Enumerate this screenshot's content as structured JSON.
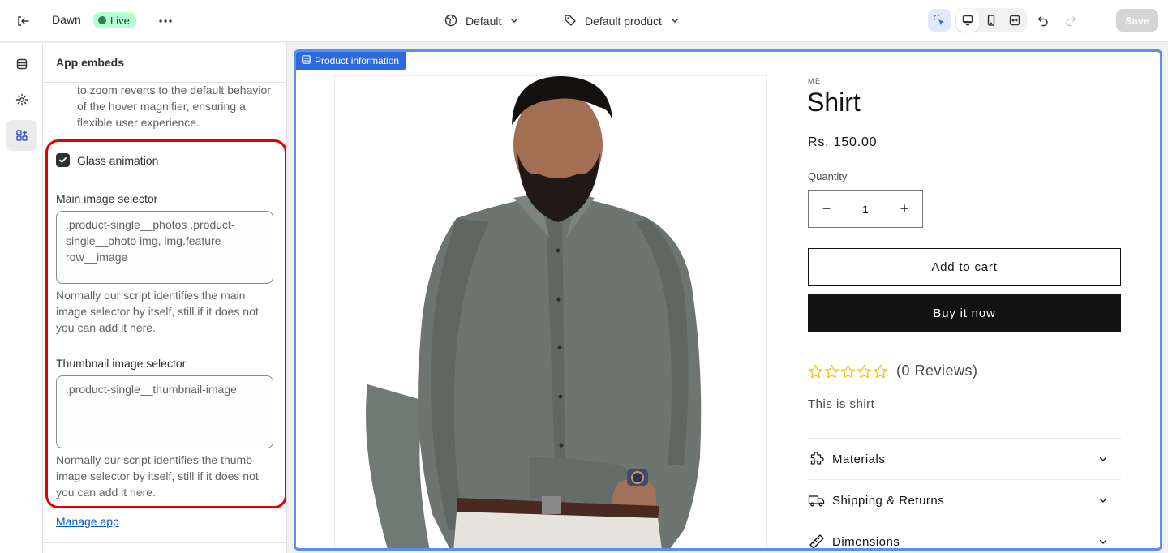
{
  "topbar": {
    "theme_name": "Dawn",
    "status": "Live",
    "more_label": "•••",
    "template_selector": "Default",
    "product_selector": "Default product",
    "save_label": "Save"
  },
  "panel": {
    "title": "App embeds",
    "help_top": "to zoom reverts to the default behavior of the hover magnifier, ensuring a flexible user experience.",
    "checkbox_label": "Glass animation",
    "main_selector": {
      "label": "Main image selector",
      "value": ".product-single__photos .product-single__photo img, img.feature-row__image",
      "help": "Normally our script identifies the main image selector by itself, still if it does not you can add it here."
    },
    "thumb_selector": {
      "label": "Thumbnail image selector",
      "value": ".product-single__thumbnail-image",
      "help": "Normally our script identifies the thumb image selector by itself, still if it does not you can add it here."
    },
    "manage_link": "Manage app"
  },
  "preview": {
    "section_tag": "Product information",
    "vendor": "ME",
    "title": "Shirt",
    "price": "Rs. 150.00",
    "quantity_label": "Quantity",
    "quantity_value": "1",
    "add_to_cart": "Add to cart",
    "buy_now": "Buy it now",
    "rating": 0,
    "rating_max": 5,
    "reviews": "(0 Reviews)",
    "description": "This is shirt",
    "accordions": [
      {
        "label": "Materials",
        "icon": "puzzle-icon"
      },
      {
        "label": "Shipping & Returns",
        "icon": "truck-icon"
      },
      {
        "label": "Dimensions",
        "icon": "ruler-icon"
      }
    ]
  },
  "colors": {
    "live_badge_bg": "#b4fed2",
    "selection_outline": "#5a8ff0",
    "section_tag_bg": "#2d6ae0",
    "highlight_box": "#e00000",
    "star": "#f5c518",
    "link": "#005bd3"
  }
}
